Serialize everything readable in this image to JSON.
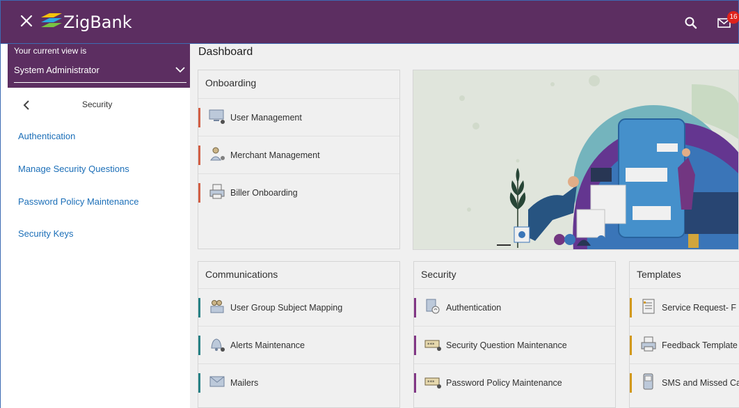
{
  "header": {
    "brand": "ZigBank",
    "notification_count": "16"
  },
  "sidebar": {
    "view_label": "Your current view is",
    "view_value": "System Administrator",
    "section_title": "Security",
    "links": [
      {
        "label": "Authentication"
      },
      {
        "label": "Manage Security Questions"
      },
      {
        "label": "Password Policy Maintenance"
      },
      {
        "label": "Security Keys"
      }
    ]
  },
  "main": {
    "title": "Dashboard",
    "onboarding": {
      "title": "Onboarding",
      "items": [
        {
          "label": "User Management",
          "icon": "monitor-user-icon"
        },
        {
          "label": "Merchant Management",
          "icon": "merchant-icon"
        },
        {
          "label": "Biller Onboarding",
          "icon": "printer-icon"
        }
      ]
    },
    "communications": {
      "title": "Communications",
      "items": [
        {
          "label": "User Group Subject Mapping",
          "icon": "group-icon"
        },
        {
          "label": "Alerts Maintenance",
          "icon": "bell-icon"
        },
        {
          "label": "Mailers",
          "icon": "mail-icon"
        }
      ]
    },
    "security": {
      "title": "Security",
      "items": [
        {
          "label": "Authentication",
          "icon": "fingerprint-icon"
        },
        {
          "label": "Security Question Maintenance",
          "icon": "password-field-icon"
        },
        {
          "label": "Password Policy Maintenance",
          "icon": "password-field-icon"
        }
      ]
    },
    "templates": {
      "title": "Templates",
      "items": [
        {
          "label": "Service Request- F",
          "icon": "form-icon"
        },
        {
          "label": "Feedback Template",
          "icon": "printer-icon"
        },
        {
          "label": "SMS and Missed Ca",
          "icon": "sms-icon"
        }
      ]
    }
  },
  "colors": {
    "header_bg": "#5c2e61",
    "link": "#1c6fb8",
    "onboarding_accent": "#e0654a",
    "communications_accent": "#2a8a8e",
    "security_accent": "#8a3a8e",
    "templates_accent": "#e0a21c",
    "badge": "#e0221c"
  }
}
